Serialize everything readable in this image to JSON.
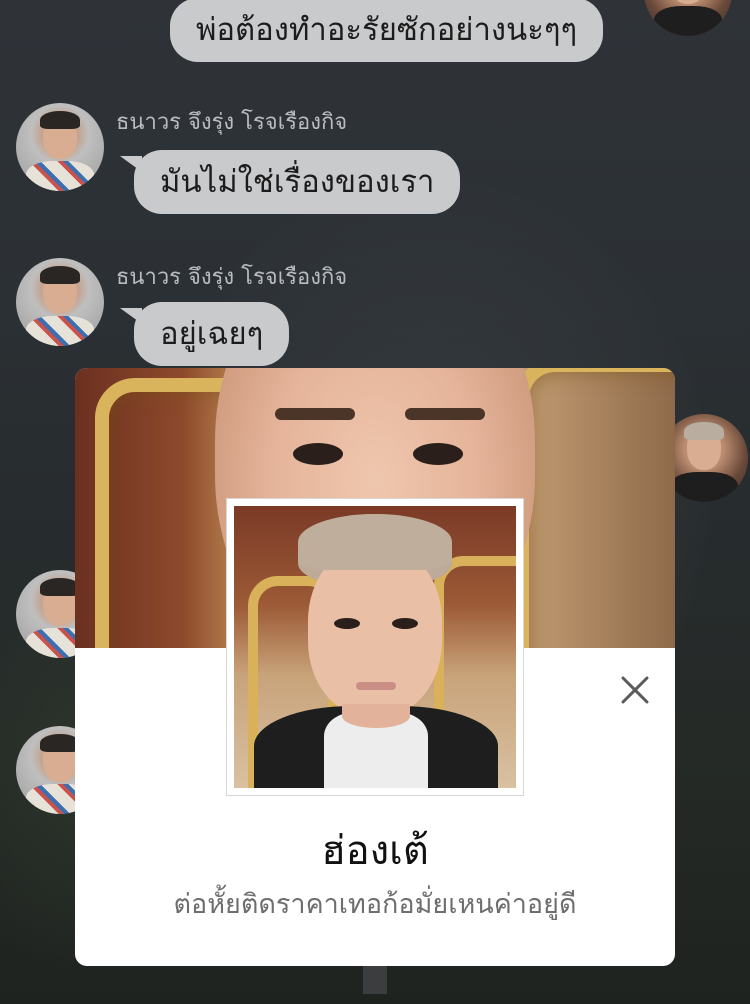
{
  "chat": {
    "messages": [
      {
        "sender": "",
        "text": "พ่อต้องทำอะรัยซักอย่างนะๆๆ"
      },
      {
        "sender": "ธนาวร จึงรุ่ง โรจเรืองกิจ",
        "text": "มันไม่ใช่เรื่องของเรา"
      },
      {
        "sender": "ธนาวร จึงรุ่ง โรจเรืองกิจ",
        "text": "อยู่เฉยๆ"
      }
    ]
  },
  "profile": {
    "name": "ฮ่องเต้",
    "status": "ต่อหั้ยติดราคาเทอก้อมั่ยเหนค่าอยู่ดี",
    "close_icon": "close-icon"
  },
  "colors": {
    "bubble": "#c9cacc",
    "card": "#ffffff",
    "sender_text": "#b9bcbf"
  }
}
